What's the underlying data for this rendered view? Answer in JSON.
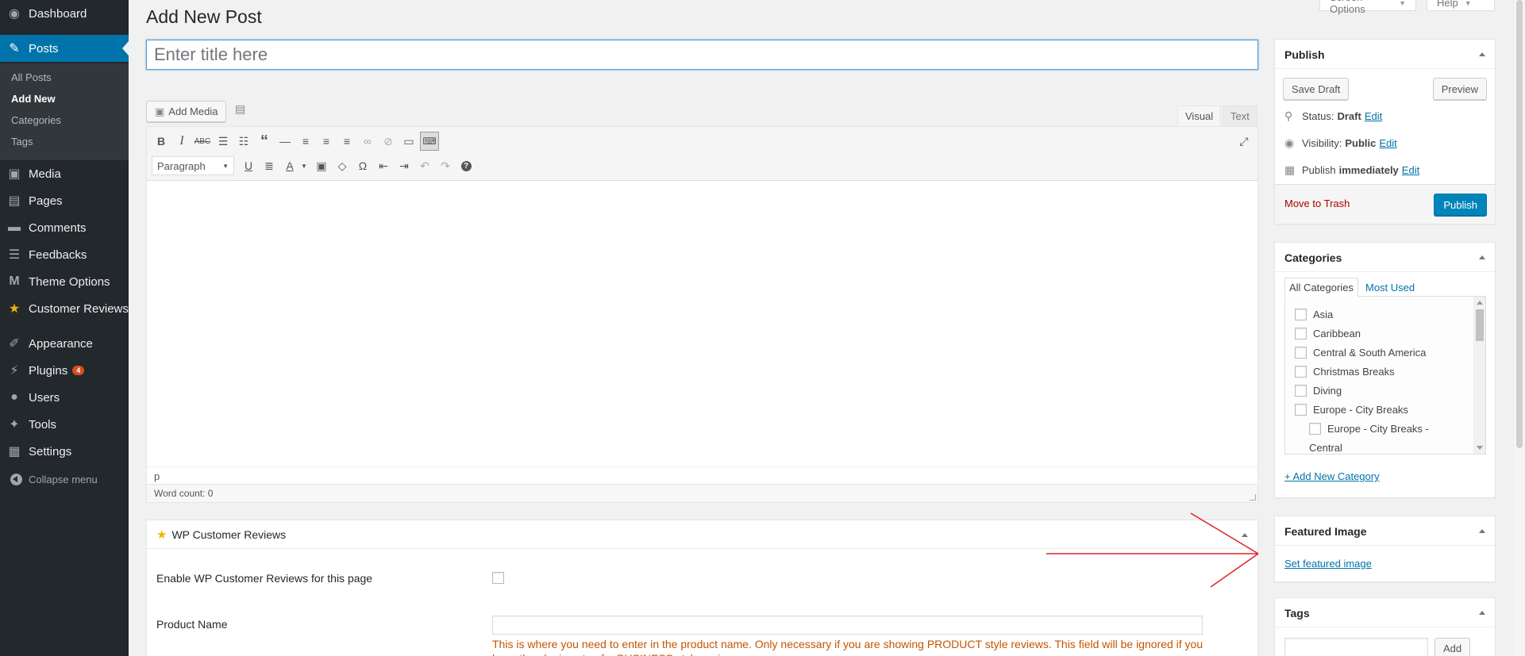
{
  "admin_menu": {
    "dashboard": "Dashboard",
    "posts": "Posts",
    "posts_sub": [
      "All Posts",
      "Add New",
      "Categories",
      "Tags"
    ],
    "media": "Media",
    "pages": "Pages",
    "comments": "Comments",
    "feedbacks": "Feedbacks",
    "theme_options": "Theme Options",
    "customer_reviews": "Customer Reviews",
    "appearance": "Appearance",
    "plugins": "Plugins",
    "plugins_badge": "4",
    "users": "Users",
    "tools": "Tools",
    "settings": "Settings",
    "collapse": "Collapse menu"
  },
  "top_tabs": {
    "screen_options": "Screen Options",
    "help": "Help"
  },
  "page_title": "Add New Post",
  "title_placeholder": "Enter title here",
  "editor": {
    "add_media": "Add Media",
    "tab_visual": "Visual",
    "tab_text": "Text",
    "format": "Paragraph",
    "path": "p",
    "word_count": "Word count: 0"
  },
  "customer_reviews_box": {
    "title": "WP Customer Reviews",
    "enable_label": "Enable WP Customer Reviews for this page",
    "product_name_label": "Product Name",
    "help_text": "This is where you need to enter in the product name. Only necessary if you are showing PRODUCT style reviews. This field will be ignored if you have the plugin setup for BUSINESS style reviews."
  },
  "publish_box": {
    "title": "Publish",
    "save_draft": "Save Draft",
    "preview": "Preview",
    "status_label": "Status:",
    "status_value": "Draft",
    "visibility_label": "Visibility:",
    "visibility_value": "Public",
    "publish_label": "Publish",
    "publish_value": "immediately",
    "edit": "Edit",
    "move_to_trash": "Move to Trash",
    "publish_button": "Publish"
  },
  "categories_box": {
    "title": "Categories",
    "tab_all": "All Categories",
    "tab_most": "Most Used",
    "items": [
      "Asia",
      "Caribbean",
      "Central & South America",
      "Christmas Breaks",
      "Diving",
      "Europe - City Breaks"
    ],
    "child_item_line1": "Europe - City Breaks -",
    "child_item_line2": "Central",
    "add_new": "+ Add New Category"
  },
  "featured_image_box": {
    "title": "Featured Image",
    "set_link": "Set featured image"
  },
  "tags_box": {
    "title": "Tags",
    "add_button": "Add"
  },
  "colors": {
    "sidebar_bg": "#23282d",
    "accent": "#0073aa",
    "publish_button": "#0085ba",
    "annotation_arrow": "#d9262b"
  }
}
